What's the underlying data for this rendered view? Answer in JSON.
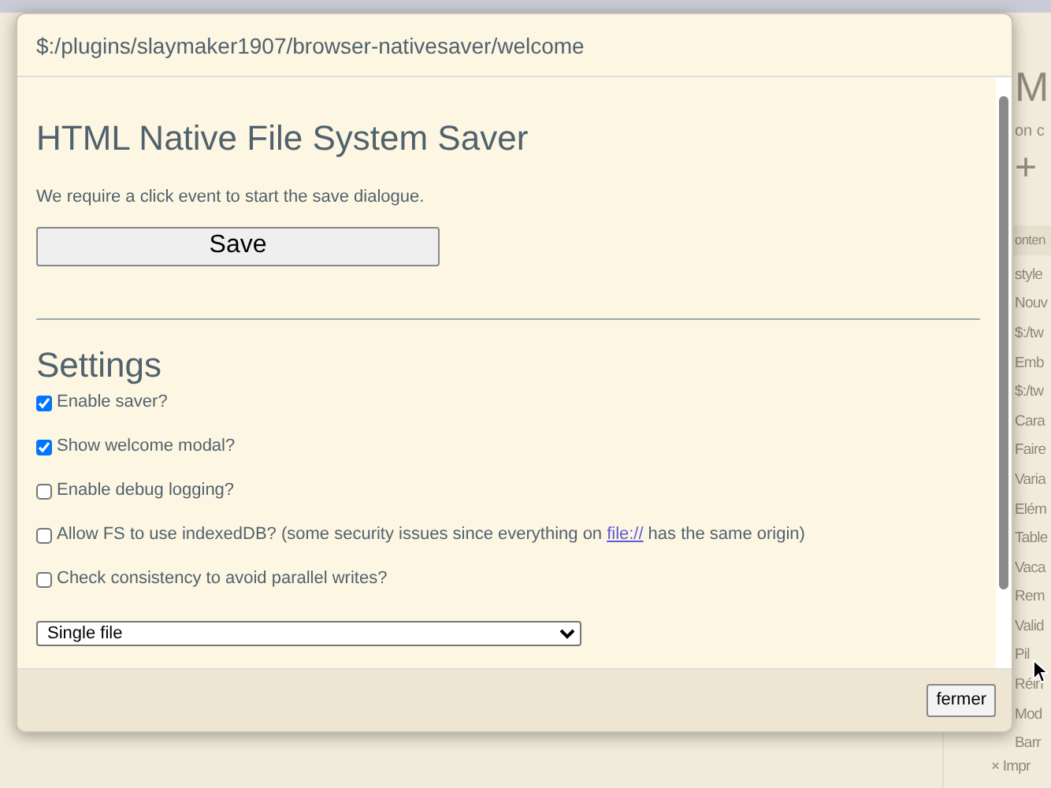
{
  "backdrop": {
    "title": "M",
    "subtitle": "on c",
    "toolbar": [
      "+"
    ],
    "tab": "onten",
    "items": [
      "style",
      "Nouv",
      "$:/tw",
      "Emb",
      "$:/tw",
      "Cara",
      "Faire",
      "Varia",
      "Elém",
      "Table",
      "Vaca",
      "Rem",
      "Valid",
      "Pil",
      "Réin",
      "Mod",
      "Barr"
    ],
    "notice": {
      "close": "×",
      "text": "Impr"
    }
  },
  "window": {
    "title": "$:/plugins/slaymaker1907/browser-nativesaver/welcome"
  },
  "heading": "HTML Native File System Saver",
  "intro": "We require a click event to start the save dialogue.",
  "save_button": "Save",
  "settings": {
    "heading": "Settings",
    "options": [
      {
        "kind": "plain",
        "label": "Enable saver?",
        "checked": true
      },
      {
        "kind": "plain",
        "label": "Show welcome modal?",
        "checked": true
      },
      {
        "kind": "plain",
        "label": "Enable debug logging?",
        "checked": false
      },
      {
        "kind": "link",
        "label": "Allow FS to use indexedDB? (some security issues since everything on",
        "link": "file://",
        "label_after": "has the same origin)",
        "checked": false
      },
      {
        "kind": "plain",
        "label": "Check consistency to avoid parallel writes?",
        "checked": false
      }
    ]
  },
  "select": {
    "value": "Single file"
  },
  "footer": {
    "close_button": "fermer"
  }
}
